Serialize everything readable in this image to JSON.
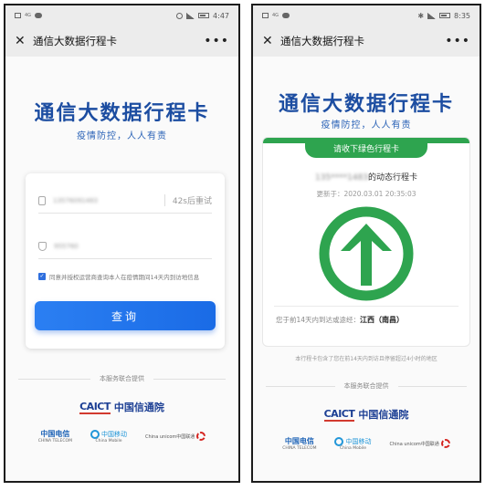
{
  "left": {
    "status": {
      "time": "4:47",
      "left_text": "4G"
    },
    "nav": {
      "close": "✕",
      "title": "通信大数据行程卡",
      "more": "•••"
    },
    "hero": {
      "title": "通信大数据行程卡",
      "subtitle": "疫情防控，人人有责"
    },
    "form": {
      "phone_value": "13576091483",
      "resend_label": "42s后重试",
      "code_value": "955760",
      "consent": "同意并授权运营商查询本人在疫情期间14天内到访地信息",
      "query_button": "查询"
    },
    "provided_by": "本服务联合提供",
    "caict": {
      "logo": "CAICT",
      "name": "中国信通院"
    },
    "carriers": [
      {
        "mark": "中国电信",
        "sub": "CHINA TELECOM"
      },
      {
        "mark": "中国移动",
        "sub": "China Mobile"
      },
      {
        "mark": "China unicom中国联通",
        "sub": ""
      }
    ]
  },
  "right": {
    "status": {
      "time": "8:35",
      "left_text": "4G"
    },
    "nav": {
      "close": "✕",
      "title": "通信大数据行程卡",
      "more": "•••"
    },
    "hero": {
      "title": "通信大数据行程卡",
      "subtitle": "疫情防控，人人有责"
    },
    "card": {
      "header": "请收下绿色行程卡",
      "phone_masked": "135****1483",
      "phone_suffix": "的动态行程卡",
      "updated": "更新于：2020.03.01 20:35:03",
      "route_prefix": "您于前14天内到达或途经：",
      "route_value": "江西（南昌）"
    },
    "footnote": "本行程卡包含了您在前14天内到访且停留超过4小时的地区",
    "provided_by": "本服务联合提供",
    "caict": {
      "logo": "CAICT",
      "name": "中国信通院"
    },
    "carriers": [
      {
        "mark": "中国电信",
        "sub": "CHINA TELECOM"
      },
      {
        "mark": "中国移动",
        "sub": "China Mobile"
      },
      {
        "mark": "China unicom中国联通",
        "sub": ""
      }
    ]
  },
  "colors": {
    "brand_blue": "#1c4da1",
    "button_blue": "#2b7ff2",
    "green": "#2ea44f"
  }
}
